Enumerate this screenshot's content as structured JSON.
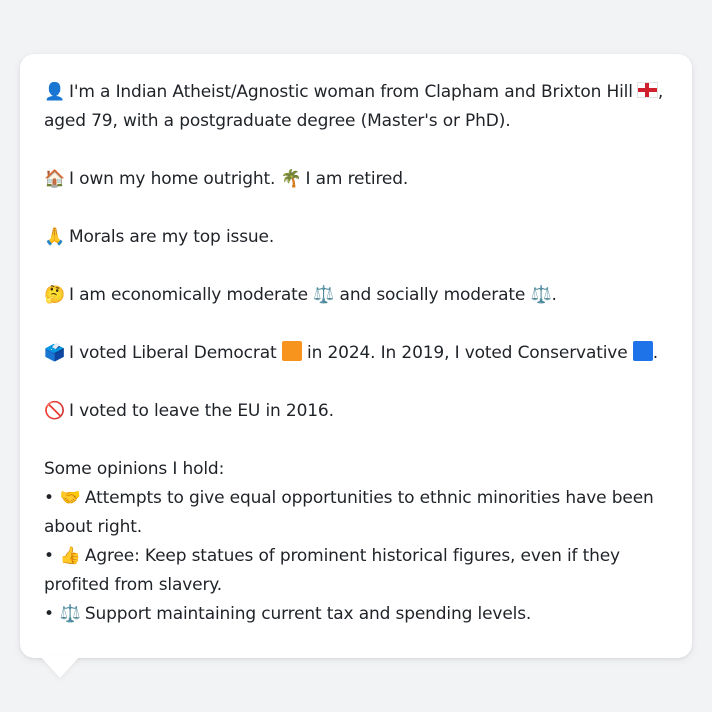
{
  "colors": {
    "background": "#f2f3f5",
    "card": "#ffffff",
    "text": "#1f2328",
    "lib_dem": "#f7941d",
    "conservative": "#1e73e8"
  },
  "identity": {
    "icon": "person-silhouette-icon",
    "emoji": "👤",
    "text_a": "I'm a Indian Atheist/Agnostic woman from Clapham and Brixton Hill",
    "flag": "england-flag-icon",
    "text_b": ",",
    "text_c": "aged 79, with a postgraduate degree (Master's or PhD)."
  },
  "home": {
    "icon": "house-icon",
    "emoji": "🏠",
    "text": "I own my home outright.",
    "retired_icon": "palm-tree-icon",
    "retired_emoji": "🌴",
    "retired_text": "I am retired."
  },
  "issue": {
    "icon": "praying-hands-icon",
    "emoji": "🙏",
    "text": "Morals are my top issue."
  },
  "ideology": {
    "icon": "thinking-face-icon",
    "emoji": "🤔",
    "text_a": "I am economically moderate",
    "scale": "⚖️",
    "text_b": "and socially moderate",
    "text_c": "."
  },
  "votes": {
    "icon": "ballot-box-icon",
    "emoji": "🗳️",
    "text_a": "I voted Liberal Democrat",
    "text_b": "in 2024. In 2019, I voted Conservative",
    "text_c": "."
  },
  "brexit": {
    "icon": "no-entry-icon",
    "emoji": "🚫",
    "text": "I voted to leave the EU in 2016."
  },
  "opinions": {
    "heading": "Some opinions I hold:",
    "bullet": "•",
    "items": [
      {
        "icon": "handshake-icon",
        "emoji": "🤝",
        "text": "Attempts to give equal opportunities to ethnic minorities have been about right."
      },
      {
        "icon": "thumbs-up-icon",
        "emoji": "👍",
        "text": "Agree: Keep statues of prominent historical figures, even if they profited from slavery."
      },
      {
        "icon": "balance-scale-icon",
        "emoji": "⚖️",
        "text": "Support maintaining current tax and spending levels."
      }
    ]
  }
}
